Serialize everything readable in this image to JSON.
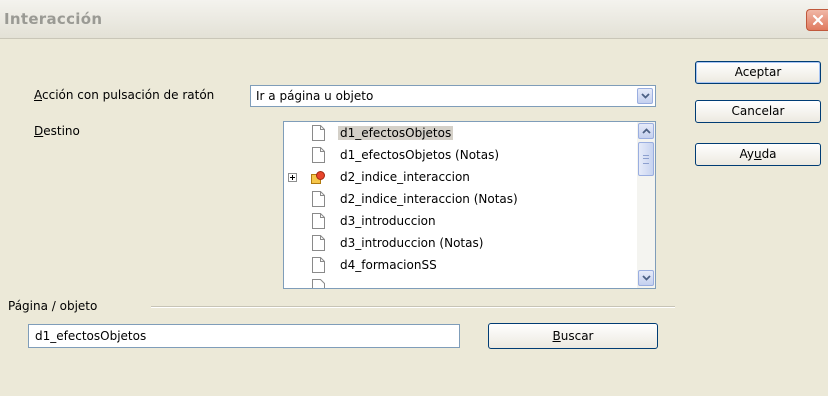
{
  "dialog": {
    "title": "Interacción"
  },
  "action": {
    "label_underlined": "A",
    "label_rest": "cción con pulsación de ratón",
    "selected": "Ir a página u objeto"
  },
  "destination": {
    "label_underlined": "D",
    "label_rest": "estino",
    "items": [
      {
        "label": "d1_efectosObjetos",
        "icon": "document-icon",
        "selected": true
      },
      {
        "label": "d1_efectosObjetos (Notas)",
        "icon": "document-icon"
      },
      {
        "label": "d2_indice_interaccion",
        "icon": "objects-icon",
        "expandable": true
      },
      {
        "label": "d2_indice_interaccion (Notas)",
        "icon": "document-icon"
      },
      {
        "label": "d3_introduccion",
        "icon": "document-icon"
      },
      {
        "label": "d3_introduccion (Notas)",
        "icon": "document-icon"
      },
      {
        "label": "d4_formacionSS",
        "icon": "document-icon"
      }
    ]
  },
  "page_object": {
    "group_label": "Página / objeto",
    "value": "d1_efectosObjetos",
    "search_underlined": "B",
    "search_rest": "uscar"
  },
  "buttons": {
    "ok": "Aceptar",
    "cancel": "Cancelar",
    "help_pre": "Ay",
    "help_underlined": "u",
    "help_post": "da"
  },
  "colors": {
    "dialog_bg": "#ece9d8",
    "button_border": "#003c74",
    "field_border": "#7f9db9",
    "selection": "#d4d0c8"
  }
}
